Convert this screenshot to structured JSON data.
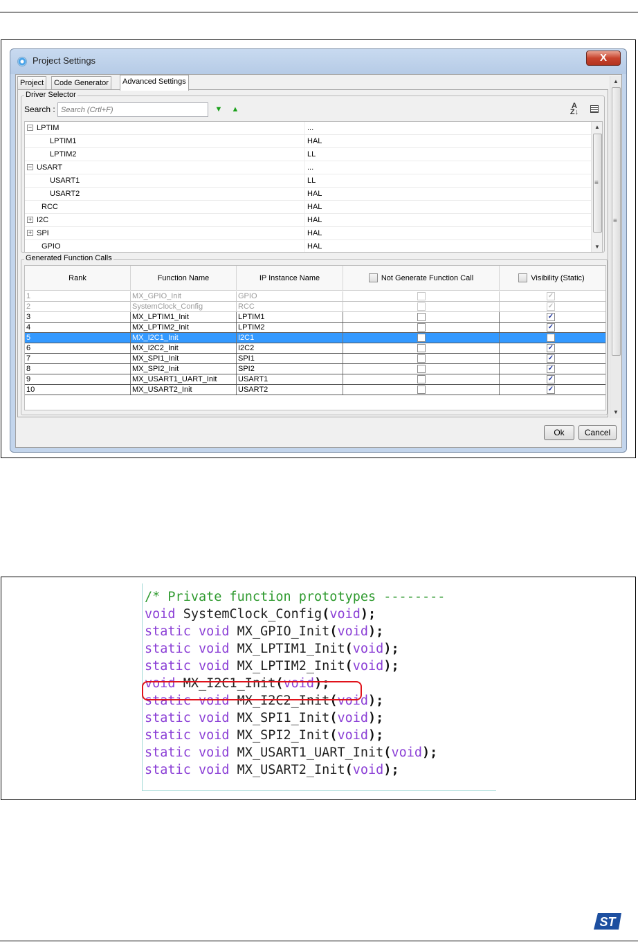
{
  "dialog": {
    "title": "Project Settings",
    "close_label": "X",
    "tabs": [
      {
        "label": "Project",
        "active": false
      },
      {
        "label": "Code Generator",
        "active": false
      },
      {
        "label": "Advanced Settings",
        "active": true
      }
    ],
    "driver_selector": {
      "label": "Driver Selector",
      "search_label": "Search :",
      "search_placeholder": "Search (Crtl+F)",
      "items": [
        {
          "name": "LPTIM",
          "value": "...",
          "expander": "−",
          "depth": 0
        },
        {
          "name": "LPTIM1",
          "value": "HAL",
          "expander": "",
          "depth": 1
        },
        {
          "name": "LPTIM2",
          "value": "LL",
          "expander": "",
          "depth": 1
        },
        {
          "name": "USART",
          "value": "...",
          "expander": "−",
          "depth": 0
        },
        {
          "name": "USART1",
          "value": "LL",
          "expander": "",
          "depth": 1
        },
        {
          "name": "USART2",
          "value": "HAL",
          "expander": "",
          "depth": 1
        },
        {
          "name": "RCC",
          "value": "HAL",
          "expander": "",
          "depth": 0.5
        },
        {
          "name": "I2C",
          "value": "HAL",
          "expander": "+",
          "depth": 0
        },
        {
          "name": "SPI",
          "value": "HAL",
          "expander": "+",
          "depth": 0
        },
        {
          "name": "GPIO",
          "value": "HAL",
          "expander": "",
          "depth": 0.5
        }
      ]
    },
    "generated_calls": {
      "label": "Generated Function Calls",
      "columns": [
        "Rank",
        "Function Name",
        "IP Instance Name",
        "Not Generate Function Call",
        "Visibility (Static)"
      ],
      "rows": [
        {
          "rank": "1",
          "function": "MX_GPIO_Init",
          "instance": "GPIO",
          "not_generate": false,
          "visibility": true,
          "enabled": false,
          "selected": false
        },
        {
          "rank": "2",
          "function": "SystemClock_Config",
          "instance": "RCC",
          "not_generate": false,
          "visibility": true,
          "enabled": false,
          "selected": false
        },
        {
          "rank": "3",
          "function": "MX_LPTIM1_Init",
          "instance": "LPTIM1",
          "not_generate": false,
          "visibility": true,
          "enabled": true,
          "selected": false
        },
        {
          "rank": "4",
          "function": "MX_LPTIM2_Init",
          "instance": "LPTIM2",
          "not_generate": false,
          "visibility": true,
          "enabled": true,
          "selected": false
        },
        {
          "rank": "5",
          "function": "MX_I2C1_Init",
          "instance": "I2C1",
          "not_generate": false,
          "visibility": false,
          "enabled": true,
          "selected": true
        },
        {
          "rank": "6",
          "function": "MX_I2C2_Init",
          "instance": "I2C2",
          "not_generate": false,
          "visibility": true,
          "enabled": true,
          "selected": false
        },
        {
          "rank": "7",
          "function": "MX_SPI1_Init",
          "instance": "SPI1",
          "not_generate": false,
          "visibility": true,
          "enabled": true,
          "selected": false
        },
        {
          "rank": "8",
          "function": "MX_SPI2_Init",
          "instance": "SPI2",
          "not_generate": false,
          "visibility": true,
          "enabled": true,
          "selected": false
        },
        {
          "rank": "9",
          "function": "MX_USART1_UART_Init",
          "instance": "USART1",
          "not_generate": false,
          "visibility": true,
          "enabled": true,
          "selected": false
        },
        {
          "rank": "10",
          "function": "MX_USART2_Init",
          "instance": "USART2",
          "not_generate": false,
          "visibility": true,
          "enabled": true,
          "selected": false
        }
      ]
    },
    "buttons": {
      "ok": "Ok",
      "cancel": "Cancel"
    }
  },
  "code": {
    "lines": [
      {
        "text": "/* Private function prototypes --------",
        "kind": "comment"
      },
      {
        "text": "void SystemClock_Config(void);",
        "kind": "code"
      },
      {
        "text": "static void MX_GPIO_Init(void);",
        "kind": "code"
      },
      {
        "text": "static void MX_LPTIM1_Init(void);",
        "kind": "code"
      },
      {
        "text": "static void MX_LPTIM2_Init(void);",
        "kind": "code"
      },
      {
        "text": "void MX_I2C1_Init(void);",
        "kind": "code",
        "highlighted": true
      },
      {
        "text": "static void MX_I2C2_Init(void);",
        "kind": "code"
      },
      {
        "text": "static void MX_SPI1_Init(void);",
        "kind": "code"
      },
      {
        "text": "static void MX_SPI2_Init(void);",
        "kind": "code"
      },
      {
        "text": "static void MX_USART1_UART_Init(void);",
        "kind": "code"
      },
      {
        "text": "static void MX_USART2_Init(void);",
        "kind": "code"
      }
    ]
  },
  "colors": {
    "keyword": "#8b3fd6",
    "comment": "#2e9a2e",
    "highlight_ring": "#e0121a",
    "selection": "#3399ff",
    "logo": "#1d4fa0"
  },
  "logo": {
    "name": "st-logo"
  }
}
